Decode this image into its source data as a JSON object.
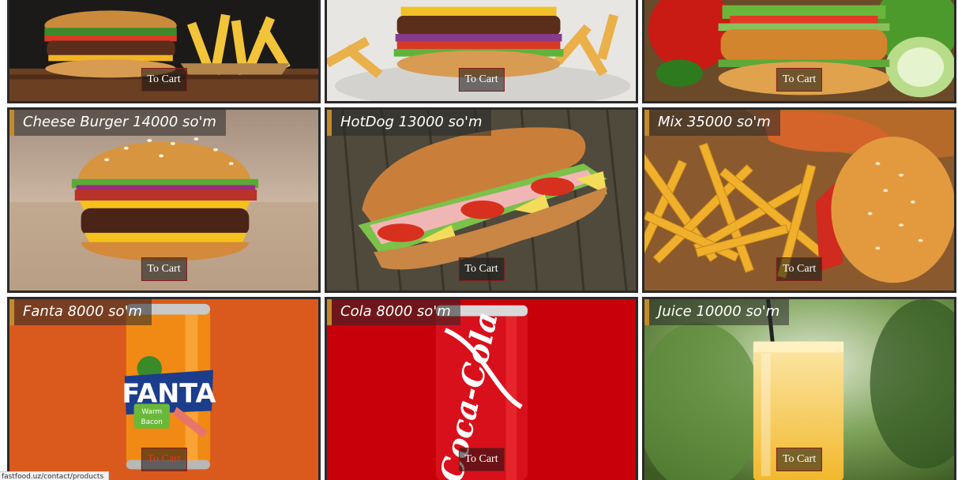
{
  "cart_label": "To Cart",
  "products": [
    {
      "title": "",
      "theme": "burger-fries-dark"
    },
    {
      "title": "",
      "theme": "burger-fries-light"
    },
    {
      "title": "",
      "theme": "chicken-burger"
    },
    {
      "title": "Cheese Burger 14000 so'm",
      "theme": "cheese-burger"
    },
    {
      "title": "HotDog 13000 so'm",
      "theme": "hotdog"
    },
    {
      "title": "Mix 35000 so'm",
      "theme": "mix"
    },
    {
      "title": "Fanta 8000 so'm",
      "theme": "fanta"
    },
    {
      "title": "Cola 8000 so'm",
      "theme": "cola"
    },
    {
      "title": "Juice 10000 so'm",
      "theme": "juice"
    }
  ],
  "fanta_can": {
    "brand": "FANTA",
    "flavor_line1": "Warm",
    "flavor_line2": "Bacon"
  },
  "cola_can": {
    "brand": "Coca-Cola"
  },
  "status_bar_url": "fastfood.uz/contact/products",
  "colors": {
    "card_border": "#2a2a2a",
    "title_accent": "#c38a2c",
    "button_border": "#8b1b1b",
    "fanta_bg": "#d95a1c",
    "cola_bg": "#c8000a"
  }
}
